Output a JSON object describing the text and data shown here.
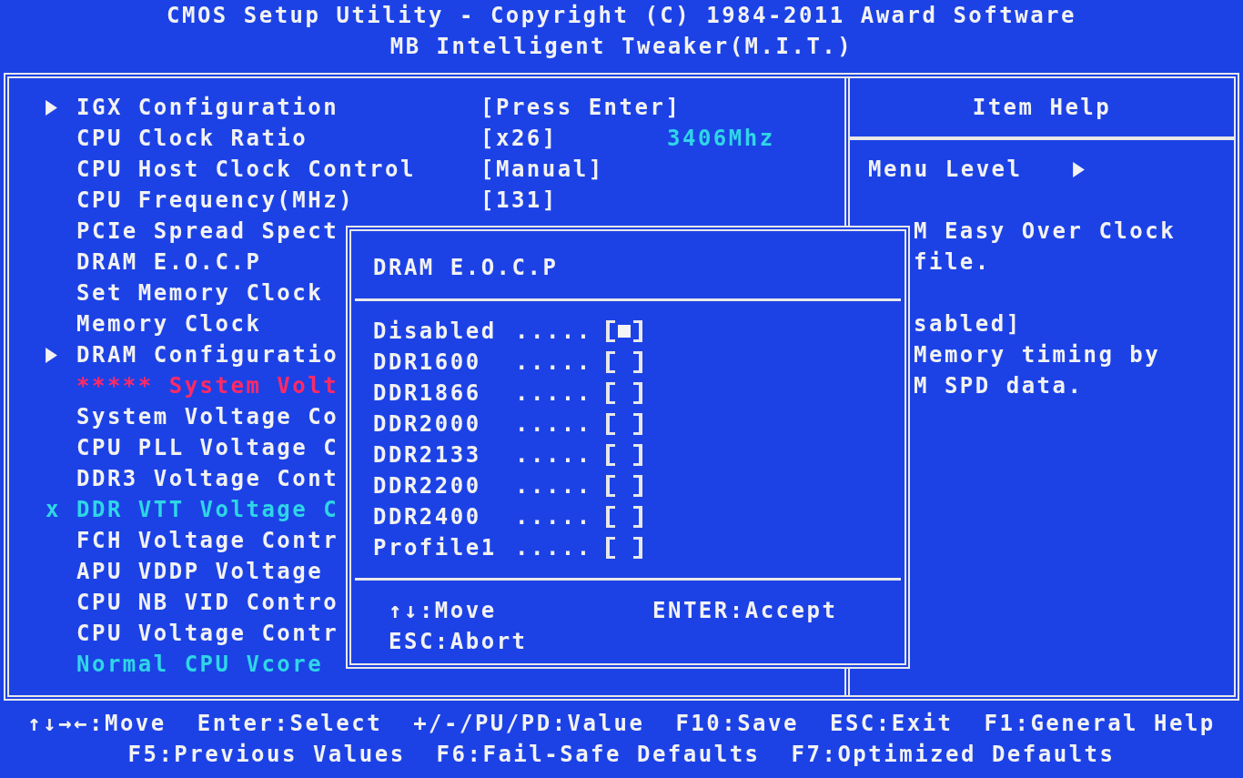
{
  "header": {
    "title": "CMOS Setup Utility - Copyright (C) 1984-2011 Award Software",
    "subtitle": "MB Intelligent Tweaker(M.I.T.)"
  },
  "menu": [
    {
      "kind": "submenu",
      "label": "IGX Configuration",
      "value": "[Press Enter]"
    },
    {
      "kind": "item",
      "label": "CPU Clock Ratio",
      "value": "[x26]",
      "extra": "3406Mhz"
    },
    {
      "kind": "item",
      "label": "CPU Host Clock Control",
      "value": "[Manual]"
    },
    {
      "kind": "item",
      "label": "CPU Frequency(MHz)",
      "value": "[131]"
    },
    {
      "kind": "item",
      "label": "PCIe Spread Spect"
    },
    {
      "kind": "item",
      "label": "DRAM E.O.C.P"
    },
    {
      "kind": "item",
      "label": "Set Memory Clock"
    },
    {
      "kind": "item",
      "label": "Memory Clock"
    },
    {
      "kind": "submenu",
      "label": "DRAM Configuratio"
    },
    {
      "kind": "heading",
      "label": "***** System Volt"
    },
    {
      "kind": "item",
      "label": "System Voltage Co"
    },
    {
      "kind": "item",
      "label": "CPU PLL Voltage C"
    },
    {
      "kind": "item",
      "label": "DDR3 Voltage Cont"
    },
    {
      "kind": "disabled",
      "marker": "x",
      "label": "DDR VTT Voltage C"
    },
    {
      "kind": "item",
      "label": "FCH Voltage Contr"
    },
    {
      "kind": "item",
      "label": "APU VDDP Voltage"
    },
    {
      "kind": "item",
      "label": "CPU NB VID Contro"
    },
    {
      "kind": "item",
      "label": "CPU Voltage Contr"
    },
    {
      "kind": "info",
      "label": "Normal CPU Vcore"
    }
  ],
  "help": {
    "title": "Item Help",
    "menu_level": "Menu Level",
    "paragraphs": [
      [
        "M Easy Over Clock",
        "file."
      ],
      [
        "sabled]",
        "Memory timing by",
        "M SPD data."
      ]
    ]
  },
  "popup": {
    "title": "DRAM E.O.C.P",
    "options": [
      {
        "label": "Disabled",
        "dots": ".....",
        "selected": true
      },
      {
        "label": "DDR1600",
        "dots": ".....",
        "selected": false
      },
      {
        "label": "DDR1866",
        "dots": ".....",
        "selected": false
      },
      {
        "label": "DDR2000",
        "dots": ".....",
        "selected": false
      },
      {
        "label": "DDR2133",
        "dots": ".....",
        "selected": false
      },
      {
        "label": "DDR2200",
        "dots": ".....",
        "selected": false
      },
      {
        "label": "DDR2400",
        "dots": ".....",
        "selected": false
      },
      {
        "label": "Profile1",
        "dots": ".....",
        "selected": false
      }
    ],
    "hints": [
      {
        "text": "↑↓:Move"
      },
      {
        "text": "ENTER:Accept"
      },
      {
        "text": "ESC:Abort"
      }
    ]
  },
  "footer": [
    [
      "↑↓→←:Move",
      "Enter:Select",
      "+/-/PU/PD:Value",
      "F10:Save",
      "ESC:Exit",
      "F1:General Help"
    ],
    [
      "F5:Previous Values",
      "F6:Fail-Safe Defaults",
      "F7:Optimized Defaults"
    ]
  ]
}
